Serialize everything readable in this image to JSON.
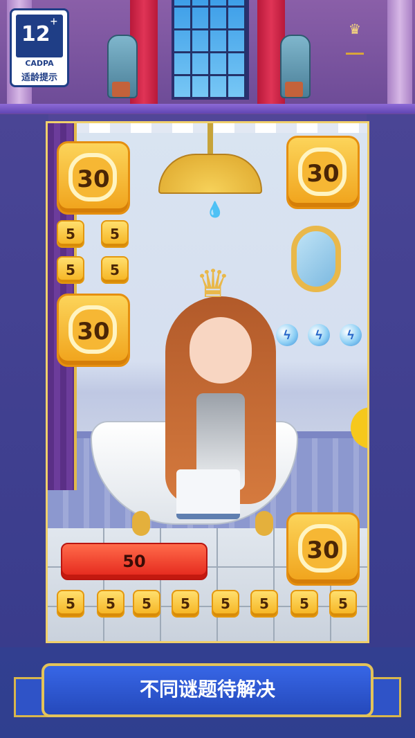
{
  "age_badge": {
    "rating": "12",
    "plus": "+",
    "org": "CADPA",
    "note": "适龄提示"
  },
  "tiles": {
    "big_left_top": "30",
    "big_right_top": "30",
    "big_left_mid": "30",
    "big_right_bottom": "30",
    "small_left": [
      "5",
      "5",
      "5",
      "5"
    ],
    "bottom_row": [
      "5",
      "5",
      "5",
      "5",
      "5",
      "5",
      "5",
      "5"
    ]
  },
  "target_bar": "50",
  "caption": "不同谜题待解决",
  "colors": {
    "accent_gold": "#f0a21a",
    "ribbon_blue": "#2549bb",
    "target_red": "#e3241a"
  }
}
